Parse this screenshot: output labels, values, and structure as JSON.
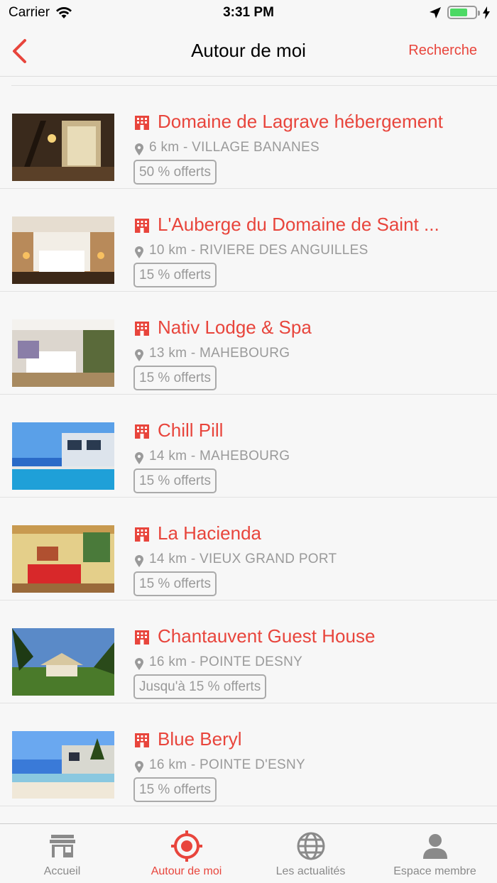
{
  "status_bar": {
    "carrier": "Carrier",
    "time": "3:31 PM",
    "battery_level": 0.7
  },
  "nav": {
    "title": "Autour de moi",
    "search_label": "Recherche",
    "accent_color": "#e8453c"
  },
  "items": [
    {
      "name": "Domaine de Lagrave hébergement",
      "distance": "6 km - VILLAGE BANANES",
      "offer": "50 % offerts"
    },
    {
      "name": "L'Auberge du Domaine de Saint ...",
      "distance": "10 km - RIVIERE DES ANGUILLES",
      "offer": "15 % offerts"
    },
    {
      "name": "Nativ Lodge & Spa",
      "distance": "13 km - MAHEBOURG",
      "offer": "15 % offerts"
    },
    {
      "name": "Chill Pill",
      "distance": "14 km - MAHEBOURG",
      "offer": "15 % offerts"
    },
    {
      "name": "La Hacienda",
      "distance": "14 km - VIEUX GRAND PORT",
      "offer": "15 % offerts"
    },
    {
      "name": "Chantauvent Guest House",
      "distance": "16 km - POINTE DESNY",
      "offer": "Jusqu'à 15 % offerts"
    },
    {
      "name": "Blue Beryl",
      "distance": "16 km - POINTE D'ESNY",
      "offer": "15 % offerts"
    }
  ],
  "tabs": [
    {
      "label": "Accueil",
      "icon": "store-icon",
      "active": false
    },
    {
      "label": "Autour de moi",
      "icon": "target-location-icon",
      "active": true
    },
    {
      "label": "Les actualités",
      "icon": "globe-icon",
      "active": false
    },
    {
      "label": "Espace membre",
      "icon": "user-icon",
      "active": false
    }
  ]
}
